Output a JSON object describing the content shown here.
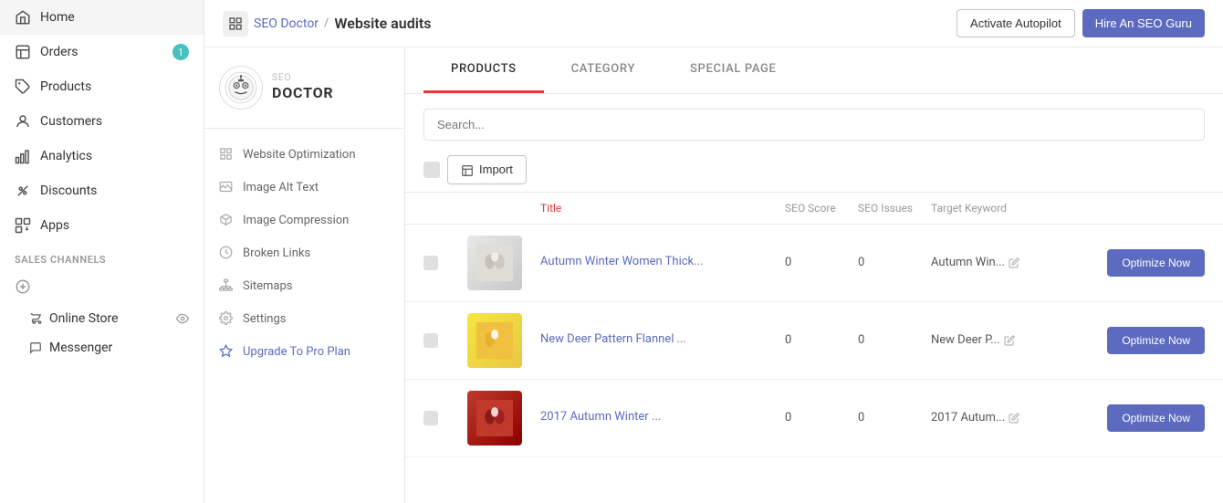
{
  "sidebar": {
    "items": [
      {
        "label": "Home",
        "icon": "home",
        "badge": null
      },
      {
        "label": "Orders",
        "icon": "orders",
        "badge": "1"
      },
      {
        "label": "Products",
        "icon": "products",
        "badge": null
      },
      {
        "label": "Customers",
        "icon": "customers",
        "badge": null
      },
      {
        "label": "Analytics",
        "icon": "analytics",
        "badge": null
      },
      {
        "label": "Discounts",
        "icon": "discounts",
        "badge": null
      },
      {
        "label": "Apps",
        "icon": "apps",
        "badge": null
      }
    ],
    "sales_channels_title": "SALES CHANNELS",
    "sales_channels": [
      {
        "label": "Online Store",
        "has_eye": true
      },
      {
        "label": "Messenger",
        "has_eye": false
      }
    ]
  },
  "header": {
    "app_icon": "◫",
    "app_name": "SEO Doctor",
    "separator": "/",
    "page_title": "Website audits",
    "btn_autopilot": "Activate Autopilot",
    "btn_guru": "Hire An SEO Guru"
  },
  "seo_sidebar": {
    "logo_small": "SEO",
    "logo_large": "DOCTOR",
    "menu": [
      {
        "label": "Website Optimization",
        "icon": "grid"
      },
      {
        "label": "Image Alt Text",
        "icon": "email"
      },
      {
        "label": "Image Compression",
        "icon": "compress"
      },
      {
        "label": "Broken Links",
        "icon": "clock"
      },
      {
        "label": "Sitemaps",
        "icon": "sitemap"
      },
      {
        "label": "Settings",
        "icon": "gear"
      },
      {
        "label": "Upgrade To Pro Plan",
        "icon": "diamond",
        "highlight": true
      }
    ]
  },
  "tabs": [
    {
      "label": "PRODUCTS",
      "active": true
    },
    {
      "label": "CATEGORY",
      "active": false
    },
    {
      "label": "SPECIAL PAGE",
      "active": false
    }
  ],
  "search": {
    "placeholder": "Search..."
  },
  "actions": {
    "import_label": "Import"
  },
  "table": {
    "headers": [
      "",
      "",
      "Title",
      "SEO Score",
      "SEO Issues",
      "Target Keyword",
      ""
    ],
    "rows": [
      {
        "title": "Autumn Winter Women Thick...",
        "seo_score": "0",
        "seo_issues": "0",
        "target_keyword": "Autumn Win...",
        "btn_label": "Optimize Now",
        "img_class": "img-1"
      },
      {
        "title": "New Deer Pattern Flannel ...",
        "seo_score": "0",
        "seo_issues": "0",
        "target_keyword": "New Deer P...",
        "btn_label": "Optimize Now",
        "img_class": "img-2"
      },
      {
        "title": "2017 Autumn Winter ...",
        "seo_score": "0",
        "seo_issues": "0",
        "target_keyword": "2017 Autum...",
        "btn_label": "Optimize Now",
        "img_class": "img-3"
      }
    ]
  }
}
